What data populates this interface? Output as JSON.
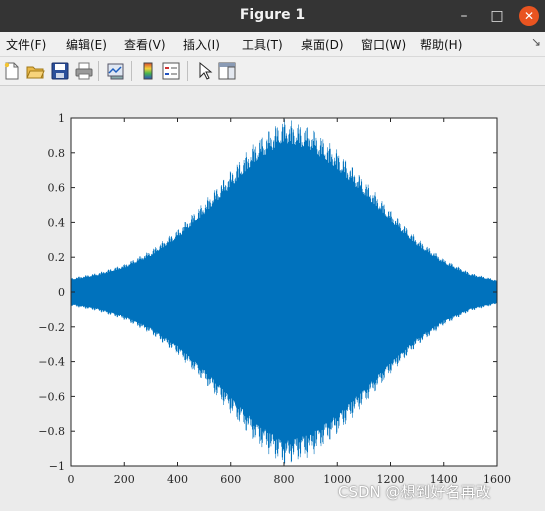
{
  "window": {
    "title": "Figure 1",
    "minimize_glyph": "–",
    "maximize_glyph": "□",
    "close_glyph": "✕"
  },
  "menu": [
    {
      "label": "文件(F)"
    },
    {
      "label": "编辑(E)"
    },
    {
      "label": "查看(V)"
    },
    {
      "label": "插入(I)"
    },
    {
      "label": "工具(T)"
    },
    {
      "label": "桌面(D)"
    },
    {
      "label": "窗口(W)"
    },
    {
      "label": "帮助(H)"
    }
  ],
  "menu_end_glyph": "↘",
  "toolbar": [
    {
      "icon": "new-figure-icon"
    },
    {
      "icon": "open-icon"
    },
    {
      "icon": "save-icon"
    },
    {
      "icon": "print-icon"
    },
    {
      "icon": "link-plot-icon"
    },
    {
      "icon": "colorbar-icon"
    },
    {
      "icon": "legend-icon"
    },
    {
      "icon": "pointer-icon"
    },
    {
      "icon": "property-editor-icon"
    }
  ],
  "watermark": "CSDN @想到好名再改",
  "colors": {
    "series": "#0072bd",
    "axes_bg": "#ffffff",
    "figure_bg": "#ebebeb"
  },
  "chart_data": {
    "type": "line",
    "title": "",
    "xlabel": "",
    "ylabel": "",
    "xlim": [
      0,
      1600
    ],
    "ylim": [
      -1,
      1
    ],
    "xticks": [
      0,
      200,
      400,
      600,
      800,
      1000,
      1200,
      1400,
      1600
    ],
    "yticks": [
      -1,
      -0.8,
      -0.6,
      -0.4,
      -0.2,
      0,
      0.2,
      0.4,
      0.6,
      0.8,
      1
    ],
    "xtick_labels": [
      "0",
      "200",
      "400",
      "600",
      "800",
      "1000",
      "1200",
      "1400",
      "1600"
    ],
    "ytick_labels": [
      "−1",
      "−0.8",
      "−0.6",
      "−0.4",
      "−0.2",
      "0",
      "0.2",
      "0.4",
      "0.6",
      "0.8",
      "1"
    ],
    "grid": false,
    "series": [
      {
        "description_kind": "gaussian-modulated oscillation",
        "envelope_x": [
          0,
          100,
          200,
          300,
          400,
          500,
          600,
          700,
          800,
          900,
          1000,
          1100,
          1200,
          1300,
          1400,
          1500,
          1600
        ],
        "envelope_y": [
          0.08,
          0.11,
          0.16,
          0.24,
          0.36,
          0.52,
          0.7,
          0.88,
          1.0,
          0.95,
          0.82,
          0.65,
          0.47,
          0.31,
          0.19,
          0.11,
          0.07
        ],
        "n_points": 1601
      }
    ]
  }
}
